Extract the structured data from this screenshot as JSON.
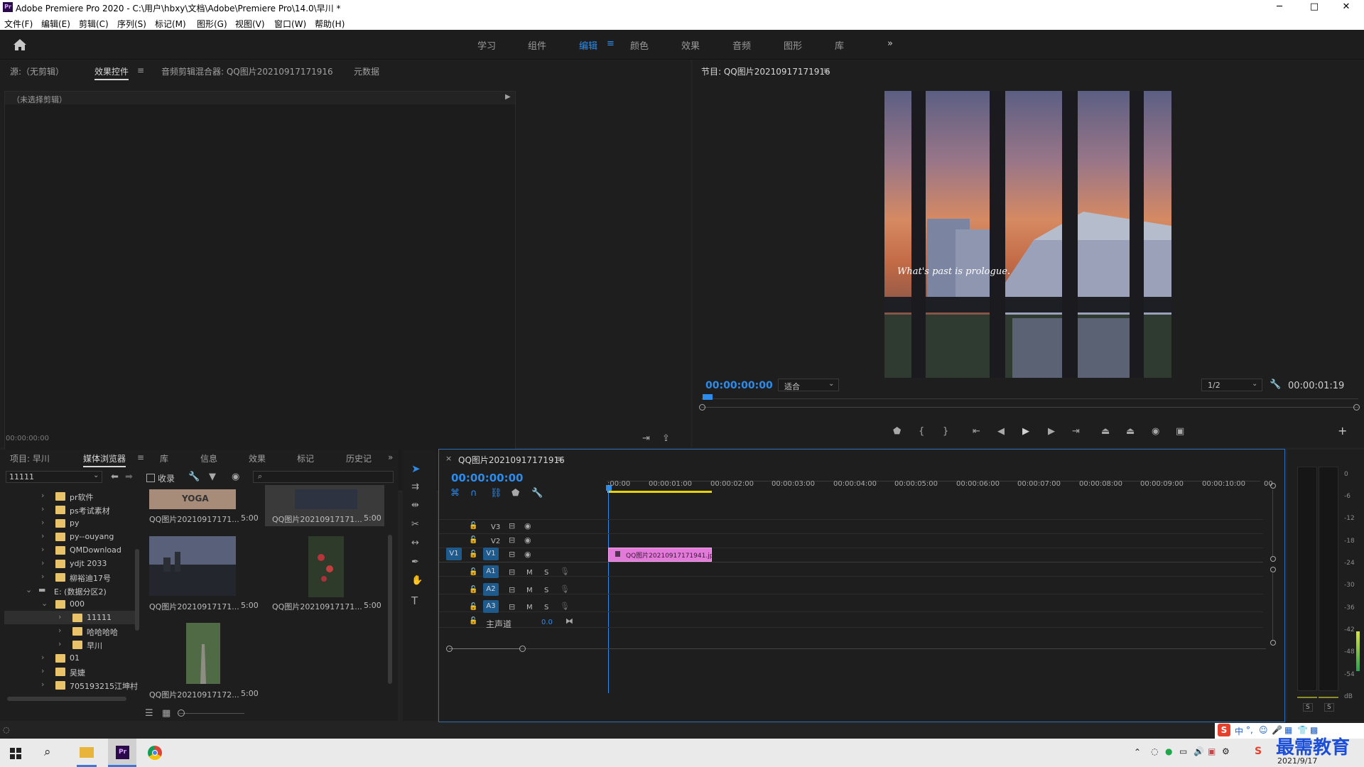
{
  "window": {
    "title": "Adobe Premiere Pro 2020 - C:\\用户\\hbxy\\文档\\Adobe\\Premiere Pro\\14.0\\早川 *",
    "app_badge": "Pr",
    "min": "─",
    "max": "□",
    "close": "✕"
  },
  "menu": [
    "文件(F)",
    "编辑(E)",
    "剪辑(C)",
    "序列(S)",
    "标记(M)",
    "图形(G)",
    "视图(V)",
    "窗口(W)",
    "帮助(H)"
  ],
  "workspaces": {
    "items": [
      "学习",
      "组件",
      "编辑",
      "颜色",
      "效果",
      "音频",
      "图形",
      "库"
    ],
    "active": "编辑",
    "more": "»"
  },
  "source_panel": {
    "tabs": [
      "源:（无剪辑）",
      "效果控件",
      "音频剪辑混合器: QQ图片20210917171916",
      "元数据"
    ],
    "active_tab": "效果控件",
    "menu_icon": "≡",
    "no_clip": "（未选择剪辑）",
    "timecode": "00:00:00:00"
  },
  "program_monitor": {
    "title": "节目: QQ图片20210917171916",
    "menu_icon": "≡",
    "timecode": "00:00:00:00",
    "fit": "适合",
    "resolution": "1/2",
    "duration": "00:00:01:19",
    "overlay_text": "What's past is prologue.",
    "add": "+"
  },
  "project_panel": {
    "tabs": [
      "项目: 早川",
      "媒体浏览器",
      "库",
      "信息",
      "效果",
      "标记",
      "历史记"
    ],
    "active_tab": "媒体浏览器",
    "menu_icon": "≡",
    "more": "»",
    "location": "11111",
    "collect_label": "收录",
    "tree": [
      {
        "label": "pr软件",
        "indent": 0
      },
      {
        "label": "ps考试素材",
        "indent": 0
      },
      {
        "label": "py",
        "indent": 0
      },
      {
        "label": "py--ouyang",
        "indent": 0
      },
      {
        "label": "QMDownload",
        "indent": 0
      },
      {
        "label": "ydjt 2033",
        "indent": 0
      },
      {
        "label": "柳裕迪17号",
        "indent": 0
      },
      {
        "label": "E: (数据分区2)",
        "indent": -1
      },
      {
        "label": "000",
        "indent": 1
      },
      {
        "label": "11111",
        "indent": 2
      },
      {
        "label": "哈哈哈哈",
        "indent": 2
      },
      {
        "label": "早川",
        "indent": 2
      },
      {
        "label": "01",
        "indent": 0
      },
      {
        "label": "吴婕",
        "indent": 0
      },
      {
        "label": "705193215江坤村",
        "indent": 0
      }
    ],
    "thumbs": [
      {
        "name": "QQ图片20210917171...",
        "dur": "5:00"
      },
      {
        "name": "QQ图片20210917171...",
        "dur": "5:00"
      },
      {
        "name": "QQ图片20210917171...",
        "dur": "5:00"
      },
      {
        "name": "QQ图片20210917171...",
        "dur": "5:00"
      },
      {
        "name": "QQ图片20210917172...",
        "dur": "5:00"
      }
    ],
    "thumb0_text": "YOGA"
  },
  "timeline": {
    "close": "×",
    "sequence": "QQ图片20210917171916",
    "menu_icon": "≡",
    "timecode": "00:00:00:00",
    "ruler": [
      ":00:00",
      "00:00:01:00",
      "00:00:02:00",
      "00:00:03:00",
      "00:00:04:00",
      "00:00:05:00",
      "00:00:06:00",
      "00:00:07:00",
      "00:00:08:00",
      "00:00:09:00",
      "00:00:10:00",
      "00"
    ],
    "video_tracks": [
      "V3",
      "V2",
      "V1"
    ],
    "audio_tracks": [
      "A1",
      "A2",
      "A3"
    ],
    "source_patch_v": "V1",
    "mute": "M",
    "solo": "S",
    "master_label": "主声道",
    "master_value": "0.0",
    "clip_name": "QQ图片20210917171941.jp"
  },
  "audio_meter": {
    "scale": [
      "0",
      "-6",
      "-12",
      "-18",
      "-24",
      "-30",
      "-36",
      "-42",
      "-48",
      "-54",
      "dB"
    ],
    "solo_l": "S",
    "solo_r": "S"
  },
  "taskbar": {
    "date": "2021/9/17",
    "ime_lang": "中",
    "watermark": "最需教育"
  },
  "colors": {
    "accent": "#2d8ceb",
    "clip": "#e37ad9",
    "workarea": "#e8d200"
  }
}
